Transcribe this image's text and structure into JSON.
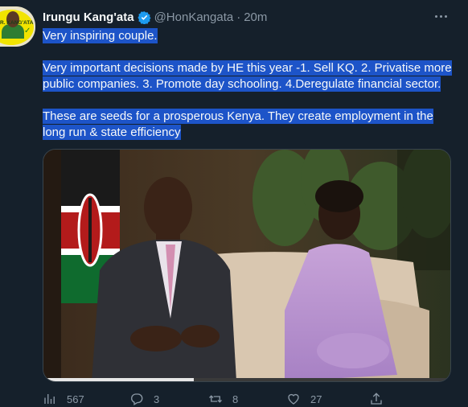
{
  "tweet": {
    "author_name": "Irungu Kang'ata",
    "author_handle": "@HonKangata",
    "time_sep": "·",
    "time": "20m",
    "avatar_text": "R. KANG'ATA",
    "lines": [
      "Very inspiring couple.",
      "",
      "Very important decisions made by HE this year -1. Sell KQ. 2. Privatise more",
      "public companies. 3. Promote day schooling. 4.Deregulate financial sector.",
      "",
      "These are seeds for a prosperous Kenya. They create employment in the",
      "long run & state efficiency"
    ],
    "highlight_color": "#1d54c8",
    "media_progress": 0.37
  },
  "actions": {
    "views": "567",
    "replies": "3",
    "retweets": "8",
    "likes": "27"
  },
  "icons": [
    "verified-badge-icon",
    "more-options-icon",
    "views-icon",
    "reply-icon",
    "retweet-icon",
    "like-icon",
    "share-icon"
  ],
  "colors": {
    "background": "#15202b",
    "secondary_text": "#8b98a5",
    "verified": "#1d9bf0"
  }
}
